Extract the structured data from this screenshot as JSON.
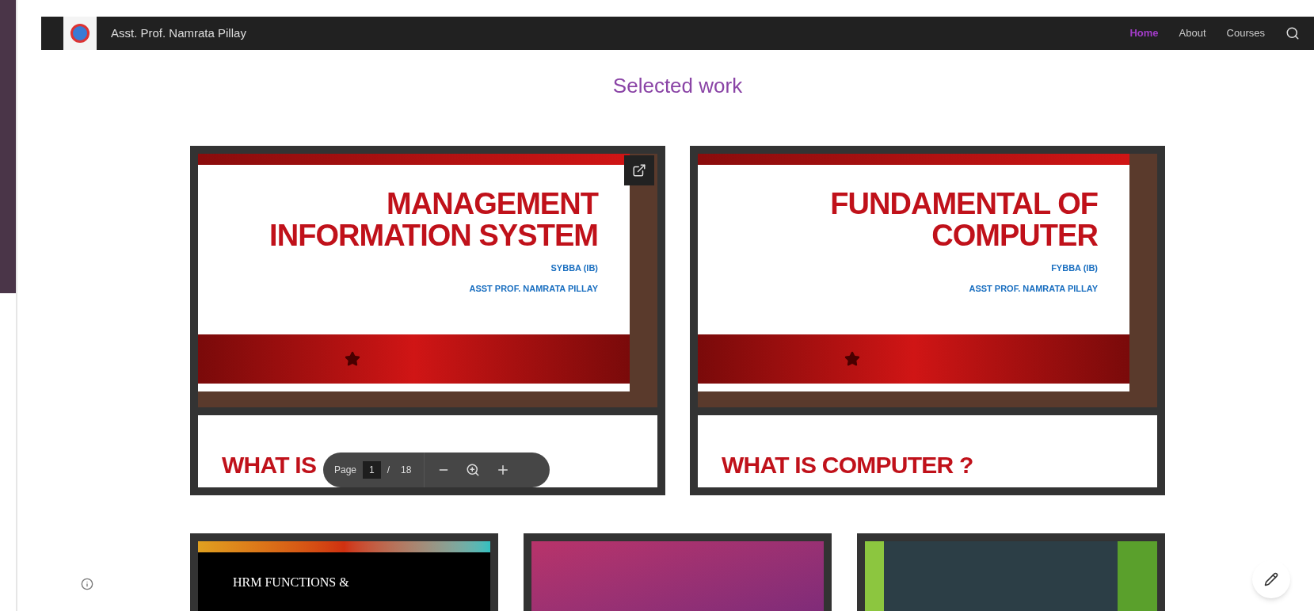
{
  "header": {
    "site_title": "Asst. Prof. Namrata Pillay",
    "nav": [
      {
        "label": "Home",
        "selected": true
      },
      {
        "label": "About",
        "selected": false
      },
      {
        "label": "Courses",
        "selected": false
      }
    ]
  },
  "section_title": "Selected work",
  "documents": [
    {
      "slide_title": "MANAGEMENT INFORMATION SYSTEM",
      "class_name": "SYBBA (IB)",
      "author": "ASST PROF. NAMRATA PILLAY",
      "next_page_heading": "WHAT IS",
      "popout": true,
      "toolbar": {
        "page_label": "Page",
        "page": "1",
        "separator": "/",
        "total": "18"
      }
    },
    {
      "slide_title": "FUNDAMENTAL OF COMPUTER",
      "class_name": "FYBBA (IB)",
      "author": "ASST PROF. NAMRATA PILLAY",
      "next_page_heading": "WHAT IS COMPUTER ?",
      "popout": false
    }
  ],
  "more_documents": [
    {
      "kind": "dark",
      "heading": "HRM FUNCTIONS &"
    },
    {
      "kind": "pink"
    },
    {
      "kind": "green"
    }
  ]
}
